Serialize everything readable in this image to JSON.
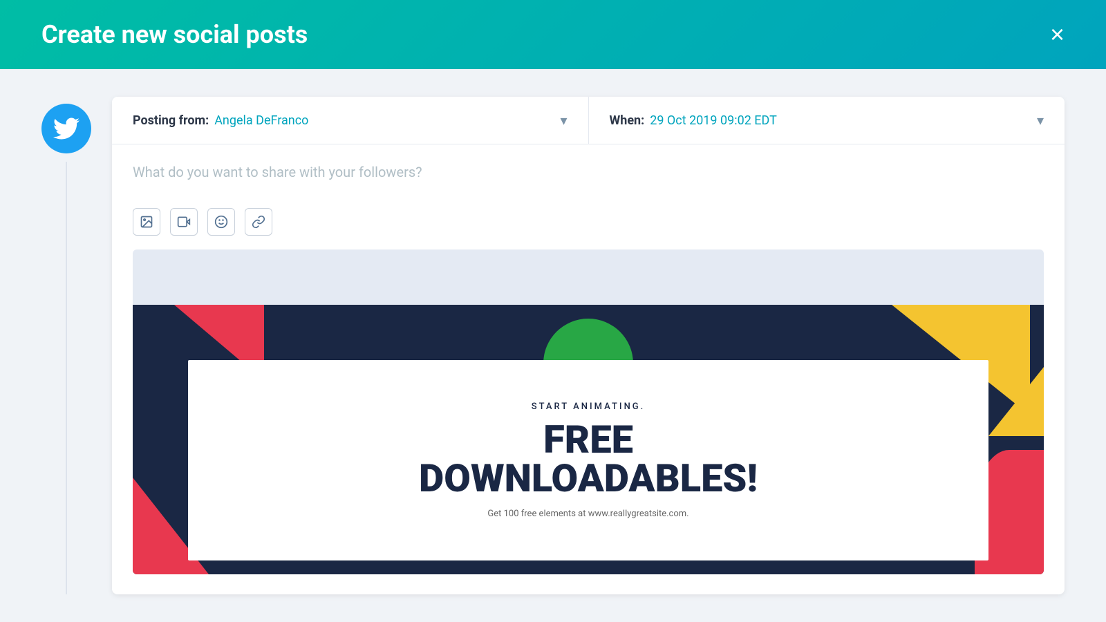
{
  "header": {
    "title": "Create new social posts",
    "close_label": "×"
  },
  "post_meta": {
    "posting_from_label": "Posting from:",
    "posting_from_value": "Angela DeFranco",
    "when_label": "When:",
    "when_value": "29 Oct 2019 09:02 EDT"
  },
  "post_content": {
    "placeholder": "What do you want to share with your followers?"
  },
  "toolbar": {
    "image_label": "🖼",
    "video_label": "🎬",
    "emoji_label": "☺",
    "link_label": "📎"
  },
  "preview": {
    "subtitle": "START ANIMATING.",
    "title": "FREE\nDOWNLOADABLES!",
    "caption": "Get 100 free elements at www.reallygreatsite.com."
  },
  "colors": {
    "accent": "#00a4bd",
    "header_gradient_start": "#00bda5",
    "header_gradient_end": "#00a4bd",
    "twitter_blue": "#1da1f2"
  }
}
